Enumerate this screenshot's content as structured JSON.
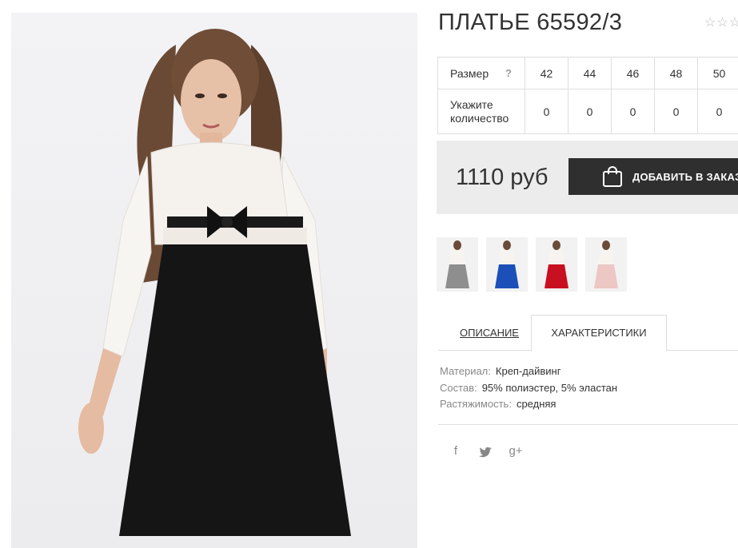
{
  "product": {
    "title": "ПЛАТЬЕ 65592/3",
    "rating_stars": "☆☆☆",
    "price": "1110 руб",
    "buy_label": "ДОБАВИТЬ В ЗАКАЗ"
  },
  "size_table": {
    "size_label": "Размер",
    "help": "?",
    "qty_label_line1": "Укажите",
    "qty_label_line2": "количество",
    "sizes": [
      "42",
      "44",
      "46",
      "48",
      "50"
    ],
    "quantities": [
      "0",
      "0",
      "0",
      "0",
      "0"
    ]
  },
  "thumbnails": [
    {
      "color": "grey",
      "dress_color": "#8e8e8e"
    },
    {
      "color": "blue",
      "dress_color": "#1c4fb8"
    },
    {
      "color": "red",
      "dress_color": "#c81020"
    },
    {
      "color": "pink",
      "dress_color": "#ecc7c4"
    }
  ],
  "tabs": {
    "description": "ОПИСАНИЕ",
    "characteristics": "ХАРАКТЕРИСТИКИ"
  },
  "specs": [
    {
      "key": "Материал:",
      "value": "Креп-дайвинг"
    },
    {
      "key": "Состав:",
      "value": "95% полиэстер, 5% эластан"
    },
    {
      "key": "Растяжимость:",
      "value": "средняя"
    }
  ],
  "social": {
    "facebook": "f",
    "twitter": "🐦",
    "google_plus": "g+"
  },
  "icons": [
    "shopping-bag-icon",
    "facebook-icon",
    "twitter-icon",
    "google-plus-icon",
    "star-icon"
  ]
}
